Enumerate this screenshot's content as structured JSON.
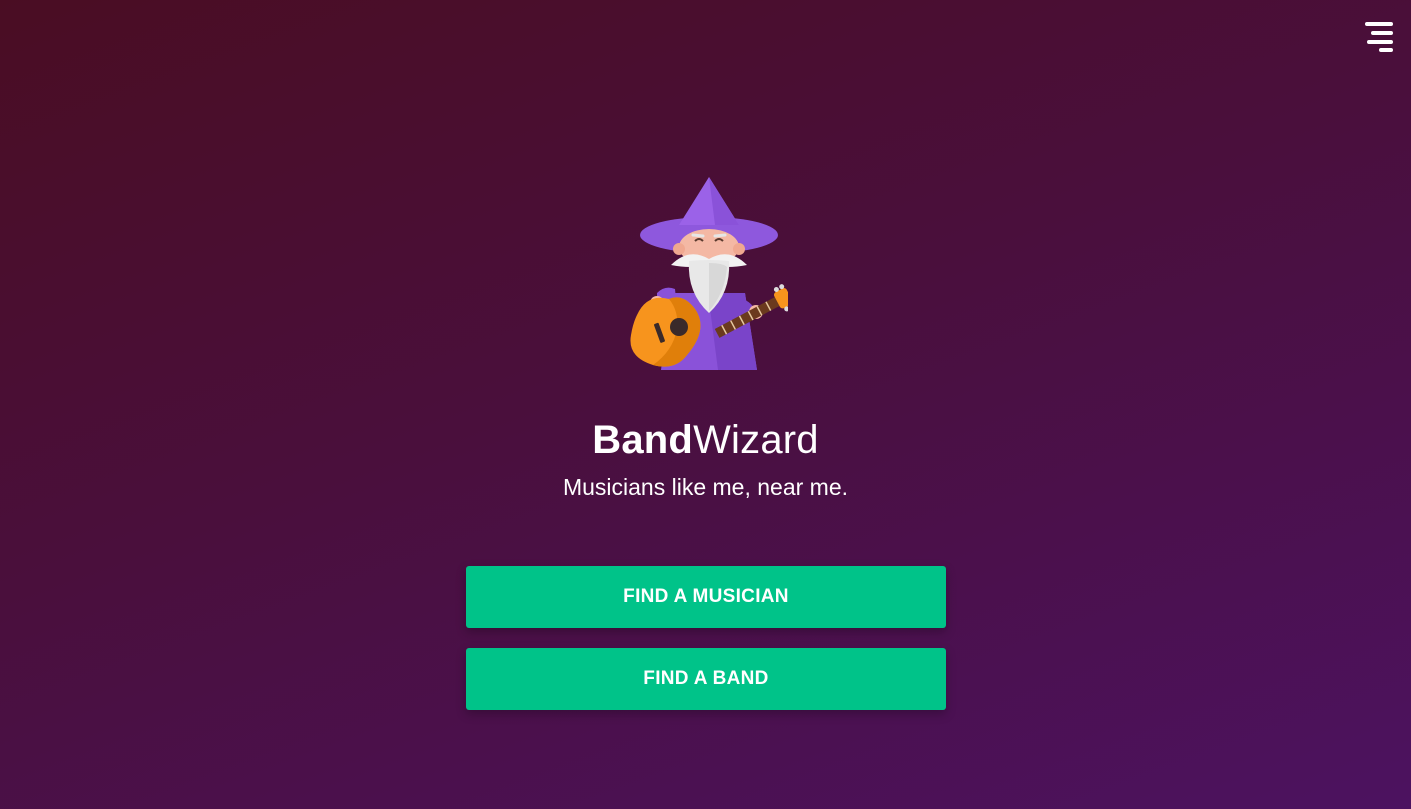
{
  "brand": {
    "name_bold": "Band",
    "name_light": "Wizard",
    "tagline": "Musicians like me, near me.",
    "mascot_icon": "wizard-with-guitar-icon"
  },
  "header": {
    "menu_icon": "hamburger-menu-icon"
  },
  "actions": {
    "find_musician_label": "FIND A MUSICIAN",
    "find_band_label": "FIND A BAND"
  },
  "colors": {
    "background_start": "#4a0d23",
    "background_end": "#4c1260",
    "button": "#00c389",
    "text": "#ffffff",
    "wizard_robe": "#9b5de5",
    "guitar": "#f7941d"
  }
}
